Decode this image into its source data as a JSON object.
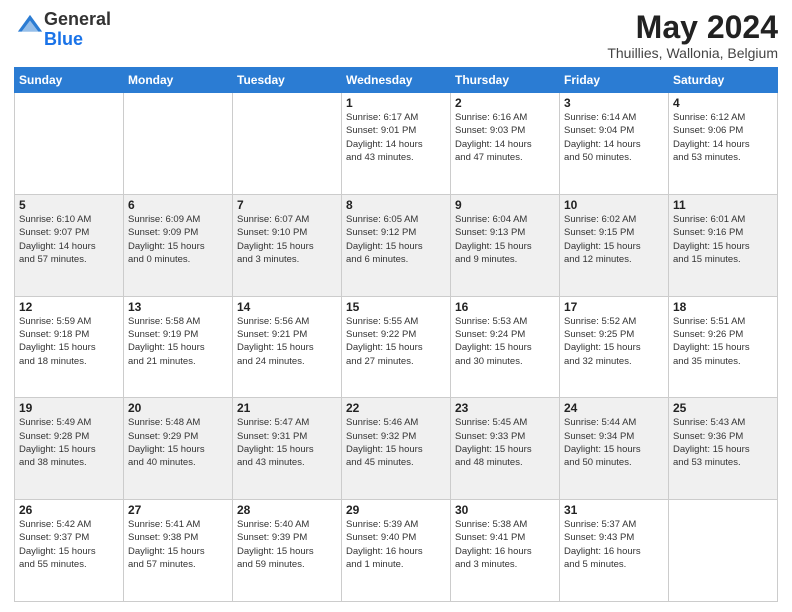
{
  "header": {
    "logo_general": "General",
    "logo_blue": "Blue",
    "month_title": "May 2024",
    "location": "Thuillies, Wallonia, Belgium"
  },
  "days_of_week": [
    "Sunday",
    "Monday",
    "Tuesday",
    "Wednesday",
    "Thursday",
    "Friday",
    "Saturday"
  ],
  "weeks": [
    [
      {
        "day": "",
        "info": ""
      },
      {
        "day": "",
        "info": ""
      },
      {
        "day": "",
        "info": ""
      },
      {
        "day": "1",
        "info": "Sunrise: 6:17 AM\nSunset: 9:01 PM\nDaylight: 14 hours\nand 43 minutes."
      },
      {
        "day": "2",
        "info": "Sunrise: 6:16 AM\nSunset: 9:03 PM\nDaylight: 14 hours\nand 47 minutes."
      },
      {
        "day": "3",
        "info": "Sunrise: 6:14 AM\nSunset: 9:04 PM\nDaylight: 14 hours\nand 50 minutes."
      },
      {
        "day": "4",
        "info": "Sunrise: 6:12 AM\nSunset: 9:06 PM\nDaylight: 14 hours\nand 53 minutes."
      }
    ],
    [
      {
        "day": "5",
        "info": "Sunrise: 6:10 AM\nSunset: 9:07 PM\nDaylight: 14 hours\nand 57 minutes."
      },
      {
        "day": "6",
        "info": "Sunrise: 6:09 AM\nSunset: 9:09 PM\nDaylight: 15 hours\nand 0 minutes."
      },
      {
        "day": "7",
        "info": "Sunrise: 6:07 AM\nSunset: 9:10 PM\nDaylight: 15 hours\nand 3 minutes."
      },
      {
        "day": "8",
        "info": "Sunrise: 6:05 AM\nSunset: 9:12 PM\nDaylight: 15 hours\nand 6 minutes."
      },
      {
        "day": "9",
        "info": "Sunrise: 6:04 AM\nSunset: 9:13 PM\nDaylight: 15 hours\nand 9 minutes."
      },
      {
        "day": "10",
        "info": "Sunrise: 6:02 AM\nSunset: 9:15 PM\nDaylight: 15 hours\nand 12 minutes."
      },
      {
        "day": "11",
        "info": "Sunrise: 6:01 AM\nSunset: 9:16 PM\nDaylight: 15 hours\nand 15 minutes."
      }
    ],
    [
      {
        "day": "12",
        "info": "Sunrise: 5:59 AM\nSunset: 9:18 PM\nDaylight: 15 hours\nand 18 minutes."
      },
      {
        "day": "13",
        "info": "Sunrise: 5:58 AM\nSunset: 9:19 PM\nDaylight: 15 hours\nand 21 minutes."
      },
      {
        "day": "14",
        "info": "Sunrise: 5:56 AM\nSunset: 9:21 PM\nDaylight: 15 hours\nand 24 minutes."
      },
      {
        "day": "15",
        "info": "Sunrise: 5:55 AM\nSunset: 9:22 PM\nDaylight: 15 hours\nand 27 minutes."
      },
      {
        "day": "16",
        "info": "Sunrise: 5:53 AM\nSunset: 9:24 PM\nDaylight: 15 hours\nand 30 minutes."
      },
      {
        "day": "17",
        "info": "Sunrise: 5:52 AM\nSunset: 9:25 PM\nDaylight: 15 hours\nand 32 minutes."
      },
      {
        "day": "18",
        "info": "Sunrise: 5:51 AM\nSunset: 9:26 PM\nDaylight: 15 hours\nand 35 minutes."
      }
    ],
    [
      {
        "day": "19",
        "info": "Sunrise: 5:49 AM\nSunset: 9:28 PM\nDaylight: 15 hours\nand 38 minutes."
      },
      {
        "day": "20",
        "info": "Sunrise: 5:48 AM\nSunset: 9:29 PM\nDaylight: 15 hours\nand 40 minutes."
      },
      {
        "day": "21",
        "info": "Sunrise: 5:47 AM\nSunset: 9:31 PM\nDaylight: 15 hours\nand 43 minutes."
      },
      {
        "day": "22",
        "info": "Sunrise: 5:46 AM\nSunset: 9:32 PM\nDaylight: 15 hours\nand 45 minutes."
      },
      {
        "day": "23",
        "info": "Sunrise: 5:45 AM\nSunset: 9:33 PM\nDaylight: 15 hours\nand 48 minutes."
      },
      {
        "day": "24",
        "info": "Sunrise: 5:44 AM\nSunset: 9:34 PM\nDaylight: 15 hours\nand 50 minutes."
      },
      {
        "day": "25",
        "info": "Sunrise: 5:43 AM\nSunset: 9:36 PM\nDaylight: 15 hours\nand 53 minutes."
      }
    ],
    [
      {
        "day": "26",
        "info": "Sunrise: 5:42 AM\nSunset: 9:37 PM\nDaylight: 15 hours\nand 55 minutes."
      },
      {
        "day": "27",
        "info": "Sunrise: 5:41 AM\nSunset: 9:38 PM\nDaylight: 15 hours\nand 57 minutes."
      },
      {
        "day": "28",
        "info": "Sunrise: 5:40 AM\nSunset: 9:39 PM\nDaylight: 15 hours\nand 59 minutes."
      },
      {
        "day": "29",
        "info": "Sunrise: 5:39 AM\nSunset: 9:40 PM\nDaylight: 16 hours\nand 1 minute."
      },
      {
        "day": "30",
        "info": "Sunrise: 5:38 AM\nSunset: 9:41 PM\nDaylight: 16 hours\nand 3 minutes."
      },
      {
        "day": "31",
        "info": "Sunrise: 5:37 AM\nSunset: 9:43 PM\nDaylight: 16 hours\nand 5 minutes."
      },
      {
        "day": "",
        "info": ""
      }
    ]
  ]
}
